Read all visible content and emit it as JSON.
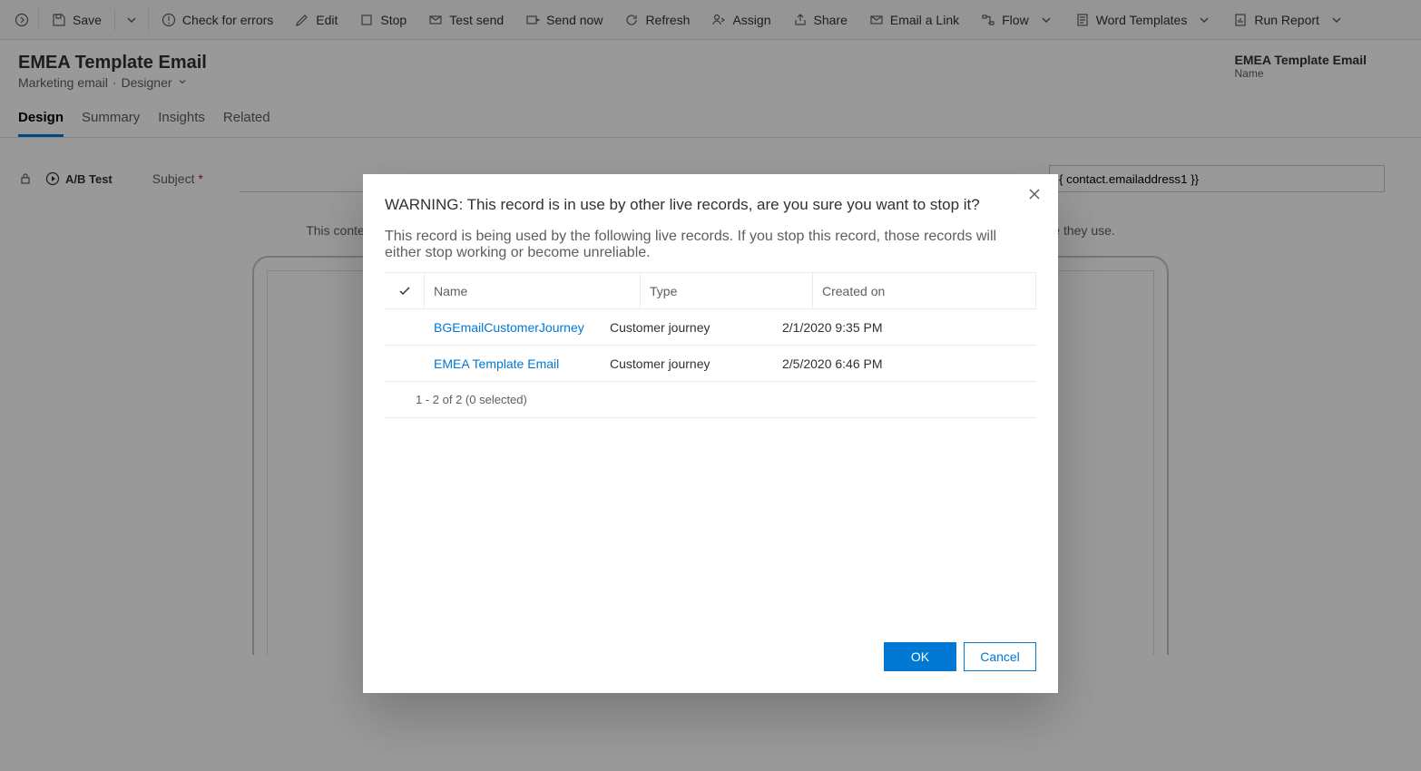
{
  "commandBar": {
    "save": "Save",
    "checkErrors": "Check for errors",
    "edit": "Edit",
    "stop": "Stop",
    "testSend": "Test send",
    "sendNow": "Send now",
    "refresh": "Refresh",
    "assign": "Assign",
    "share": "Share",
    "emailLink": "Email a Link",
    "flow": "Flow",
    "wordTemplates": "Word Templates",
    "runReport": "Run Report"
  },
  "header": {
    "title": "EMEA Template Email",
    "subtitle_type": "Marketing email",
    "subtitle_view": "Designer",
    "right_value": "EMEA Template Email",
    "right_label": "Name"
  },
  "tabs": {
    "design": "Design",
    "summary": "Summary",
    "insights": "Insights",
    "related": "Related"
  },
  "design": {
    "ab_test": "A/B Test",
    "subject_label": "Subject",
    "contact_token": "{ contact.emailaddress1 }}",
    "note": "This content was not generated by Microsoft. Actual email might look slightly different depending on which email client and screen size they use."
  },
  "dialog": {
    "title": "WARNING: This record is in use by other live records, are you sure you want to stop it?",
    "description": "This record is being used by the following live records. If you stop this record, those records will either stop working or become unreliable.",
    "columns": {
      "name": "Name",
      "type": "Type",
      "created": "Created on"
    },
    "rows": [
      {
        "name": "BGEmailCustomerJourney",
        "type": "Customer journey",
        "created": "2/1/2020 9:35 PM"
      },
      {
        "name": "EMEA Template Email",
        "type": "Customer journey",
        "created": "2/5/2020 6:46 PM"
      }
    ],
    "pager": "1 - 2 of 2 (0 selected)",
    "ok": "OK",
    "cancel": "Cancel"
  }
}
